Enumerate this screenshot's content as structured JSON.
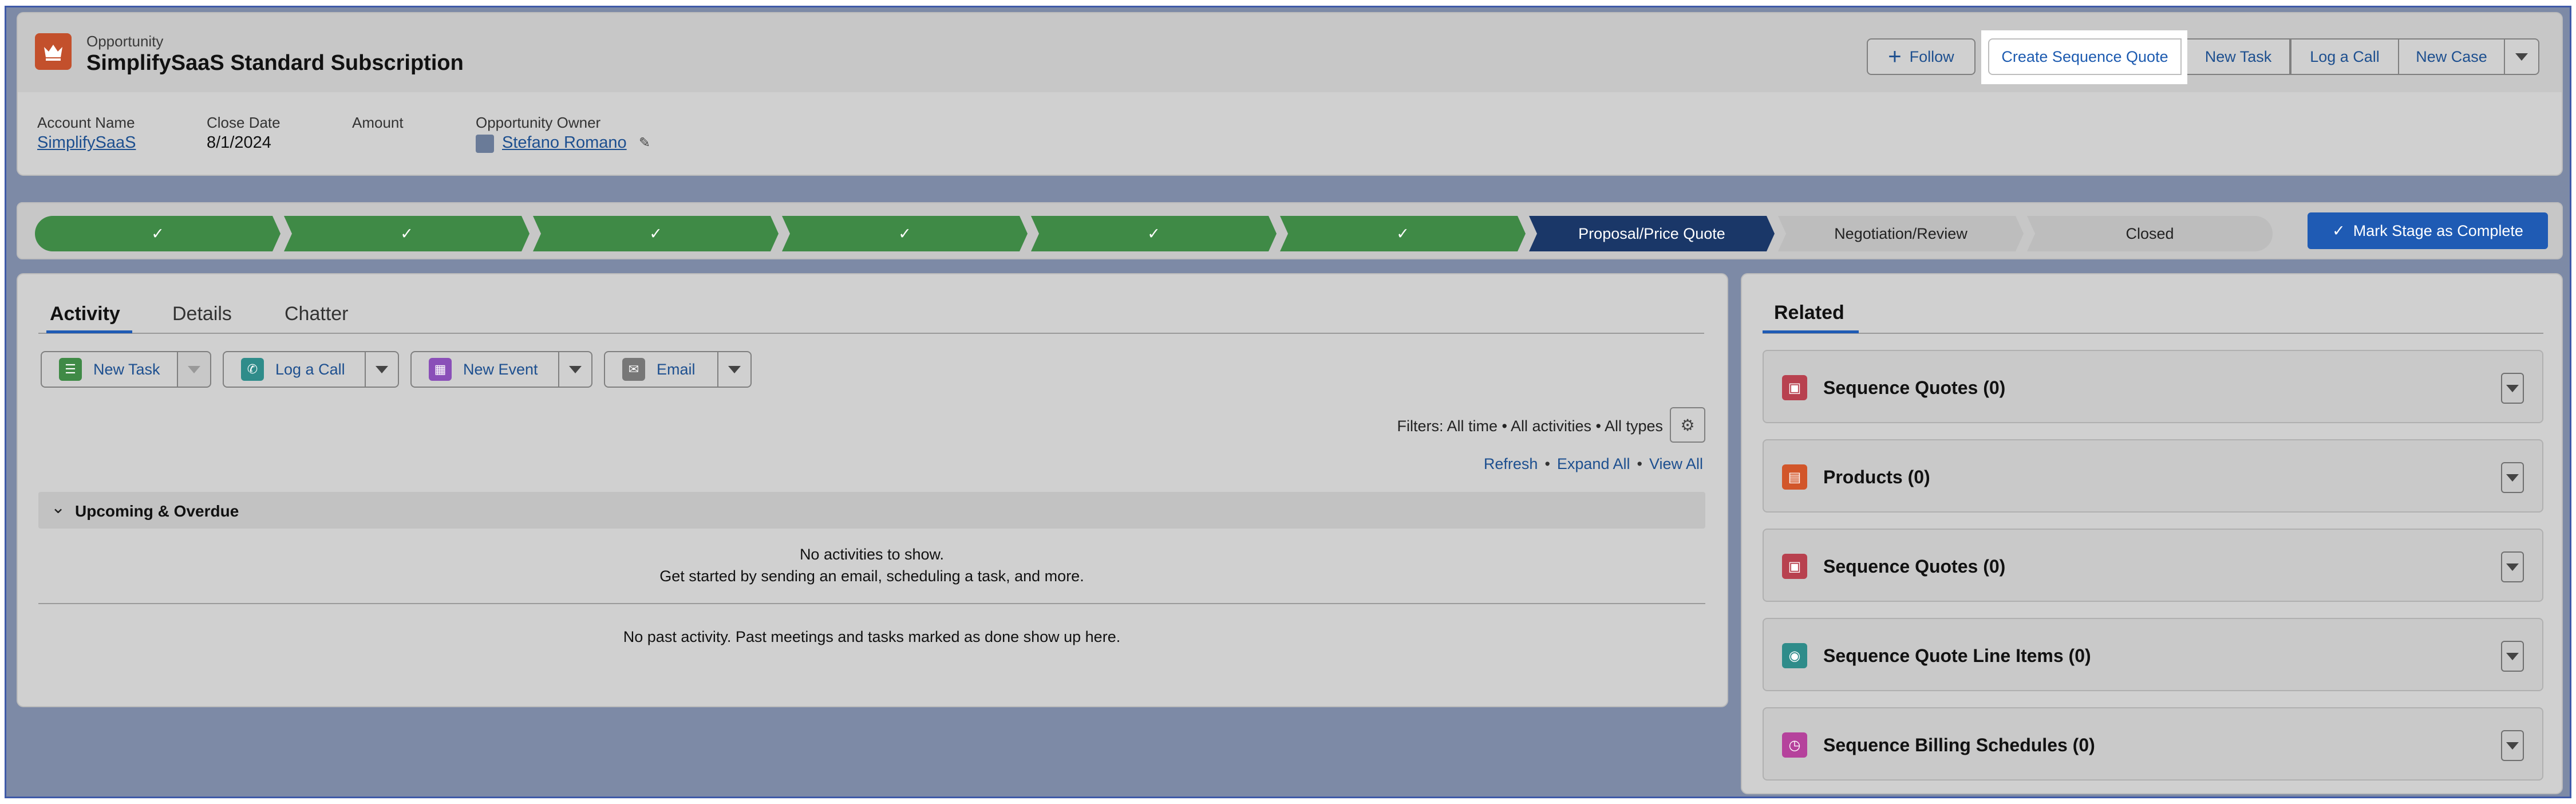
{
  "colors": {
    "stage_done": "#3f8a46",
    "stage_current": "#1a3768",
    "brand_blue": "#1f5bb4",
    "link_blue": "#1d4f8f"
  },
  "header": {
    "object_label": "Opportunity",
    "title": "SimplifySaaS Standard Subscription",
    "record_icon": "crown-icon",
    "buttons": {
      "follow": "Follow",
      "create_sequence_quote": "Create Sequence Quote",
      "new_task": "New Task",
      "log_a_call": "Log a Call",
      "new_case": "New Case"
    },
    "fields": {
      "account_name_label": "Account Name",
      "account_name_value": "SimplifySaaS",
      "close_date_label": "Close Date",
      "close_date_value": "8/1/2024",
      "amount_label": "Amount",
      "amount_value": "",
      "owner_label": "Opportunity Owner",
      "owner_value": "Stefano Romano"
    }
  },
  "path": {
    "stages": [
      {
        "label": "",
        "status": "done"
      },
      {
        "label": "",
        "status": "done"
      },
      {
        "label": "",
        "status": "done"
      },
      {
        "label": "",
        "status": "done"
      },
      {
        "label": "",
        "status": "done"
      },
      {
        "label": "",
        "status": "done"
      },
      {
        "label": "Proposal/Price Quote",
        "status": "current"
      },
      {
        "label": "Negotiation/Review",
        "status": "todo"
      },
      {
        "label": "Closed",
        "status": "todo"
      }
    ],
    "mark_complete": "Mark Stage as Complete"
  },
  "activity": {
    "tabs": {
      "activity": "Activity",
      "details": "Details",
      "chatter": "Chatter"
    },
    "publisher": {
      "new_task": "New Task",
      "log_a_call": "Log a Call",
      "new_event": "New Event",
      "email": "Email"
    },
    "filters": "Filters: All time • All activities • All types",
    "links": {
      "refresh": "Refresh",
      "expand_all": "Expand All",
      "view_all": "View All"
    },
    "upcoming_label": "Upcoming & Overdue",
    "no_activities": "No activities to show.",
    "get_started": "Get started by sending an email, scheduling a task, and more.",
    "no_past": "No past activity. Past meetings and tasks marked as done show up here."
  },
  "related": {
    "tab": "Related",
    "lists": [
      {
        "title": "Sequence Quotes (0)",
        "icon": "archive-icon",
        "color": "#b8414f"
      },
      {
        "title": "Products (0)",
        "icon": "products-icon",
        "color": "#d2562a"
      },
      {
        "title": "Sequence Quotes (0)",
        "icon": "archive-icon",
        "color": "#b8414f"
      },
      {
        "title": "Sequence Quote Line Items (0)",
        "icon": "line-items-icon",
        "color": "#2f8c8a"
      },
      {
        "title": "Sequence Billing Schedules (0)",
        "icon": "clock-icon",
        "color": "#b5429c"
      }
    ]
  }
}
